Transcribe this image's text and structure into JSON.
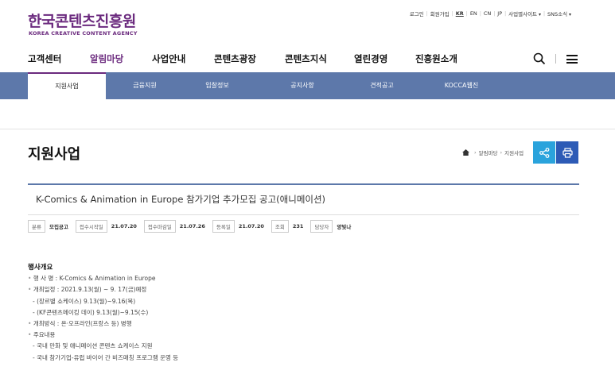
{
  "header": {
    "logo_ko": "한국콘텐츠진흥원",
    "logo_en": "KOREA CREATIVE CONTENT AGENCY",
    "util": [
      {
        "label": "로그인",
        "active": false,
        "dd": false
      },
      {
        "label": "회원가입",
        "active": false,
        "dd": false
      },
      {
        "label": "KR",
        "active": true,
        "dd": false
      },
      {
        "label": "EN",
        "active": false,
        "dd": false
      },
      {
        "label": "CN",
        "active": false,
        "dd": false
      },
      {
        "label": "JP",
        "active": false,
        "dd": false
      },
      {
        "label": "사업별사이트",
        "active": false,
        "dd": true
      },
      {
        "label": "SNS소식",
        "active": false,
        "dd": true
      }
    ]
  },
  "gnb": {
    "items": [
      "고객센터",
      "알림마당",
      "사업안내",
      "콘텐츠광장",
      "콘텐츠지식",
      "열린경영",
      "진흥원소개"
    ],
    "active_index": 1
  },
  "subnav": {
    "items": [
      "지원사업",
      "금융지원",
      "입찰정보",
      "공지사항",
      "견적공고",
      "KOCCA웹진"
    ],
    "active_index": 0
  },
  "page": {
    "title": "지원사업",
    "breadcrumb": [
      "알림마당",
      "지원사업"
    ]
  },
  "post": {
    "title": "K-Comics & Animation in Europe 참가기업 추가모집 공고(애니메이션)",
    "meta": [
      {
        "label": "분류",
        "value": "모집공고"
      },
      {
        "label": "접수시작일",
        "value": "21.07.20"
      },
      {
        "label": "접수마감일",
        "value": "21.07.26"
      },
      {
        "label": "등록일",
        "value": "21.07.20"
      },
      {
        "label": "조회",
        "value": "231"
      },
      {
        "label": "담당자",
        "value": "양빛나"
      }
    ],
    "content": {
      "heading": "행사개요",
      "lines": [
        {
          "type": "b",
          "text": "행 사 명 : K-Comics & Animation in Europe"
        },
        {
          "type": "b",
          "text": "개최일정 : 2021.9.13(월) ~ 9. 17(금)예정"
        },
        {
          "type": "d",
          "text": "(장르별 쇼케이스) 9.13(월)~9.16(목)"
        },
        {
          "type": "d",
          "text": "(KF콘텐츠메이킹 데이) 9.13(월)~9.15(수)"
        },
        {
          "type": "b",
          "text": "개최방식 : 온·오프라인(프랑스 등) 병행"
        },
        {
          "type": "b",
          "text": "주요내용"
        },
        {
          "type": "d",
          "text": "국내 만화 및 애니메이션 콘텐츠 쇼케이스 지원"
        },
        {
          "type": "d",
          "text": "국내 참가기업-유럽 바이어 간 비즈매칭 프로그램 운영 등"
        }
      ]
    }
  }
}
